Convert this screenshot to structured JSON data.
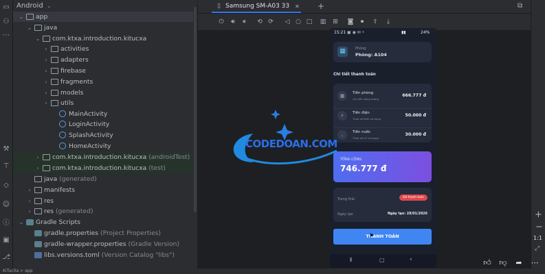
{
  "project": {
    "view_label": "Android",
    "tree": [
      {
        "label": "app",
        "suffix": ""
      },
      {
        "label": "java",
        "suffix": ""
      },
      {
        "label": "com.ktxa.introduction.kitucxa",
        "suffix": ""
      },
      {
        "label": "activities",
        "suffix": ""
      },
      {
        "label": "adapters",
        "suffix": ""
      },
      {
        "label": "firebase",
        "suffix": ""
      },
      {
        "label": "fragments",
        "suffix": ""
      },
      {
        "label": "models",
        "suffix": ""
      },
      {
        "label": "utils",
        "suffix": ""
      },
      {
        "label": "MainActivity",
        "suffix": ""
      },
      {
        "label": "LoginActivity",
        "suffix": ""
      },
      {
        "label": "SplashActivity",
        "suffix": ""
      },
      {
        "label": "HomeActivity",
        "suffix": ""
      },
      {
        "label": "com.ktxa.introduction.kitucxa",
        "suffix": "(androidTest)"
      },
      {
        "label": "com.ktxa.introduction.kitucxa",
        "suffix": "(test)"
      },
      {
        "label": "java",
        "suffix": "(generated)"
      },
      {
        "label": "manifests",
        "suffix": ""
      },
      {
        "label": "res",
        "suffix": ""
      },
      {
        "label": "res",
        "suffix": "(generated)"
      },
      {
        "label": "Gradle Scripts",
        "suffix": ""
      },
      {
        "label": "gradle.properties",
        "suffix": "(Project Properties)"
      },
      {
        "label": "gradle-wrapper.properties",
        "suffix": "(Gradle Version)"
      },
      {
        "label": "libs.versions.toml",
        "suffix": "(Version Catalog \"libs\")"
      }
    ]
  },
  "device_tab": {
    "label": "Samsung SM-A03  33"
  },
  "zoom_label": "1:1",
  "phone": {
    "status_time": "15:21",
    "status_battery": "24%",
    "room_caption": "Phòng",
    "room_value": "Phòng: A104",
    "section_title": "Chi tiết thanh toán",
    "items": [
      {
        "name": "Tiền phòng",
        "sub": "Chi tiết: đóng tháng",
        "amount": "666.777 đ"
      },
      {
        "name": "Tiền điện",
        "sub": "Theo số kWh sử dụng",
        "amount": "50.000 đ"
      },
      {
        "name": "Tiền nước",
        "sub": "Theo số m³ sử dụng",
        "amount": "30.000 đ"
      }
    ],
    "total_label": "TỔNG CỘNG",
    "total_value": "746.777 đ",
    "status_label": "Trạng thái",
    "status_badge": "Đã thanh toán",
    "date_label": "Ngày tạo",
    "date_value": "Ngày tạo: 28/01/2026",
    "pay_button": "THANH TOÁN"
  },
  "watermark": {
    "text": "CODEDOAN.COM"
  },
  "bottom": {
    "breadcrumb": "KiTucXa  >  app"
  },
  "colors": {
    "accent": "#3574f0",
    "pay_button": "#3f86f2",
    "badge": "#e0474c",
    "total_from": "#4f6df0",
    "total_to": "#7c4fe0"
  }
}
